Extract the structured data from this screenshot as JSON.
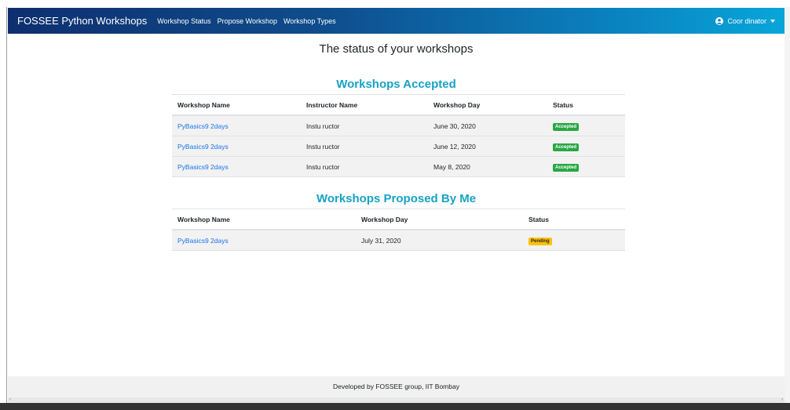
{
  "navbar": {
    "brand": "FOSSEE Python Workshops",
    "links": [
      "Workshop Status",
      "Propose Workshop",
      "Workshop Types"
    ],
    "user_label": "Coor dinator",
    "user_icon": "user-circle-icon"
  },
  "page_title": "The status of your workshops",
  "accepted": {
    "title": "Workshops Accepted",
    "headers": [
      "Workshop Name",
      "Instructor Name",
      "Workshop Day",
      "Status"
    ],
    "rows": [
      {
        "name": "PyBasics9 2days",
        "instructor": "Instu ructor",
        "day": "June 30, 2020",
        "status": "Accepted"
      },
      {
        "name": "PyBasics9 2days",
        "instructor": "Instu ructor",
        "day": "June 12, 2020",
        "status": "Accepted"
      },
      {
        "name": "PyBasics9 2days",
        "instructor": "Instu ructor",
        "day": "May 8, 2020",
        "status": "Accepted"
      }
    ]
  },
  "proposed": {
    "title": "Workshops Proposed By Me",
    "headers": [
      "Workshop Name",
      "Workshop Day",
      "Status"
    ],
    "rows": [
      {
        "name": "PyBasics9 2days",
        "day": "July 31, 2020",
        "status": "Pending"
      }
    ]
  },
  "footer": "Developed by FOSSEE group, IIT Bombay",
  "colors": {
    "accent": "#17a2c4",
    "link": "#1a73e8",
    "accepted": "#28a745",
    "pending": "#ffc107"
  }
}
